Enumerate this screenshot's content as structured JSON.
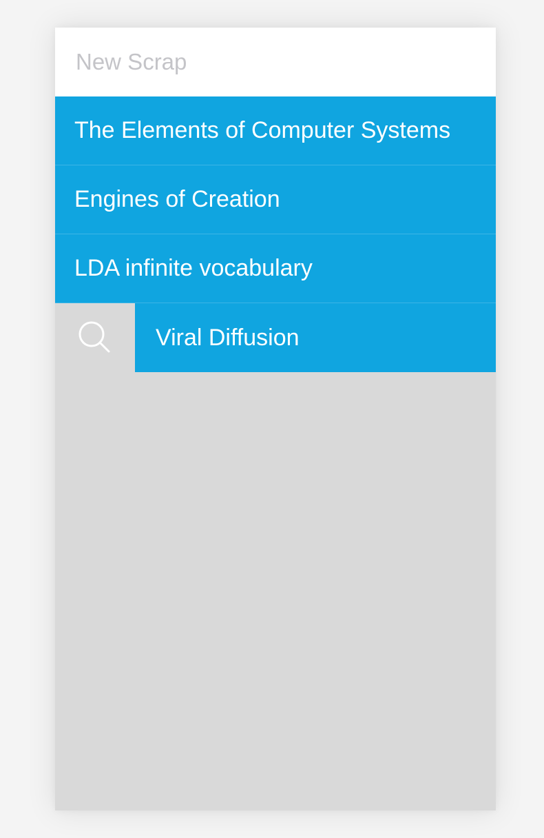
{
  "new_scrap": {
    "placeholder": "New Scrap",
    "value": ""
  },
  "scraps": [
    {
      "label": "The Elements of Computer Systems"
    },
    {
      "label": "Engines of Creation"
    },
    {
      "label": "LDA infinite vocabulary"
    }
  ],
  "swiped_scrap": {
    "label": "Viral Diffusion",
    "action_icon": "search-icon"
  },
  "colors": {
    "accent": "#10a5e0",
    "background": "#d9d9d9",
    "page": "#f4f4f4",
    "placeholder": "#c4c4c8"
  }
}
